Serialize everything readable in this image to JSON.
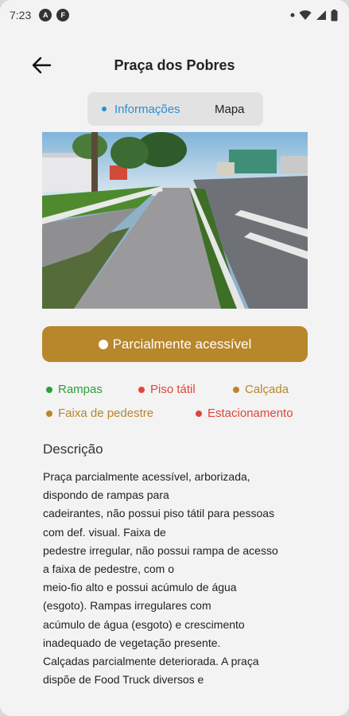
{
  "status_bar": {
    "time": "7:23"
  },
  "header": {
    "title": "Praça dos Pobres"
  },
  "tabs": [
    {
      "label": "Informações",
      "active": true
    },
    {
      "label": "Mapa",
      "active": false
    }
  ],
  "accessibility_status": {
    "label": "Parcialmente acessível",
    "color": "#b8862b"
  },
  "features": [
    {
      "label": "Rampas",
      "color": "#2e9e3a"
    },
    {
      "label": "Piso tátil",
      "color": "#e2443b"
    },
    {
      "label": "Calçada",
      "color": "#b8862b"
    },
    {
      "label": "Faixa de pedestre",
      "color": "#b8862b"
    },
    {
      "label": "Estacionamento",
      "color": "#e2443b"
    }
  ],
  "description": {
    "heading": "Descrição",
    "text": "Praça parcialmente acessível, arborizada,\ndispondo de rampas para\ncadeirantes, não possui piso tátil para pessoas\ncom def. visual. Faixa de\npedestre irregular, não possui rampa de acesso\na faixa de pedestre, com o\nmeio-fio alto e possui acúmulo de água\n(esgoto). Rampas irregulares com\nacúmulo de água (esgoto) e crescimento\ninadequado de vegetação presente.\nCalçadas parcialmente deteriorada. A praça\ndispõe de Food Truck diversos e"
  }
}
